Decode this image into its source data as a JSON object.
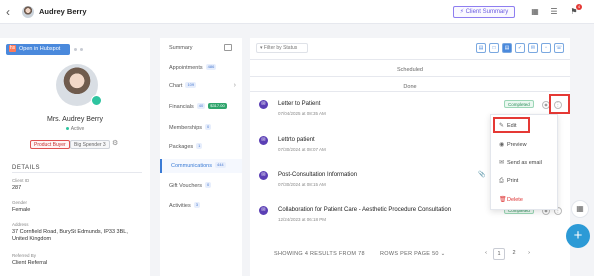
{
  "header": {
    "back_icon": "arrow-left-icon",
    "user_name": "Audrey Berry",
    "client_summary_label": "Client Summary",
    "notification_count": "4"
  },
  "profile": {
    "hubspot_label": "Open in Hubspot",
    "hubspot_icon": "hs",
    "name": "Mrs. Audrey Berry",
    "status": "Active",
    "tags": [
      "Product Buyer",
      "Big Spender"
    ],
    "big_spender_count": "3",
    "details_heading": "DETAILS",
    "fields": [
      {
        "label": "Client ID",
        "value": "287"
      },
      {
        "label": "Gender",
        "value": "Female"
      },
      {
        "label": "Address",
        "value": "37 Cornfield Road, BurySt Edmunds, IP33 3BL, United Kingdom"
      },
      {
        "label": "Referred By",
        "value": "Client Referral"
      }
    ]
  },
  "nav": {
    "items": [
      {
        "label": "Summary",
        "count": ""
      },
      {
        "label": "Appointments",
        "count": "486"
      },
      {
        "label": "Chart",
        "count": "109"
      },
      {
        "label": "Financials",
        "count": "40",
        "amount": "$317.00"
      },
      {
        "label": "Memberships",
        "count": "0"
      },
      {
        "label": "Packages",
        "count": "1"
      },
      {
        "label": "Communications",
        "count": "444"
      },
      {
        "label": "Gift Vouchers",
        "count": "0"
      },
      {
        "label": "Activities",
        "count": "3"
      }
    ]
  },
  "main": {
    "filter_label": "Filter by Status",
    "scheduled_label": "Scheduled",
    "done_label": "Done",
    "communications": [
      {
        "title": "Letter to Patient",
        "date": "07/04/2025 at 08:35 AM",
        "status": "Completed"
      },
      {
        "title": "Lettrto patient",
        "date": "07/30/2024 at 08:07 AM",
        "status": ""
      },
      {
        "title": "Post-Consultation Information",
        "date": "07/30/2024 at 08:15 AM",
        "status": ""
      },
      {
        "title": "Collaboration for Patient Care - Aesthetic Procedure Consultation",
        "date": "12/24/2023 at 06:18 PM",
        "status": "Completed"
      }
    ],
    "menu": [
      {
        "label": "Edit",
        "icon": "pencil-icon"
      },
      {
        "label": "Preview",
        "icon": "eye-icon"
      },
      {
        "label": "Send as email",
        "icon": "mail-icon"
      },
      {
        "label": "Print",
        "icon": "printer-icon"
      },
      {
        "label": "Delete",
        "icon": "trash-icon"
      }
    ]
  },
  "footer": {
    "showing": "SHOWING 4 RESULTS FROM 78",
    "rows_per_page": "ROWS PER PAGE 50",
    "pages": [
      "1",
      "2"
    ]
  },
  "colors": {
    "accent": "#4a89dc",
    "brand_purple": "#5b3fb5",
    "status_green": "#2c8c5a",
    "highlight_red": "#e53935"
  }
}
